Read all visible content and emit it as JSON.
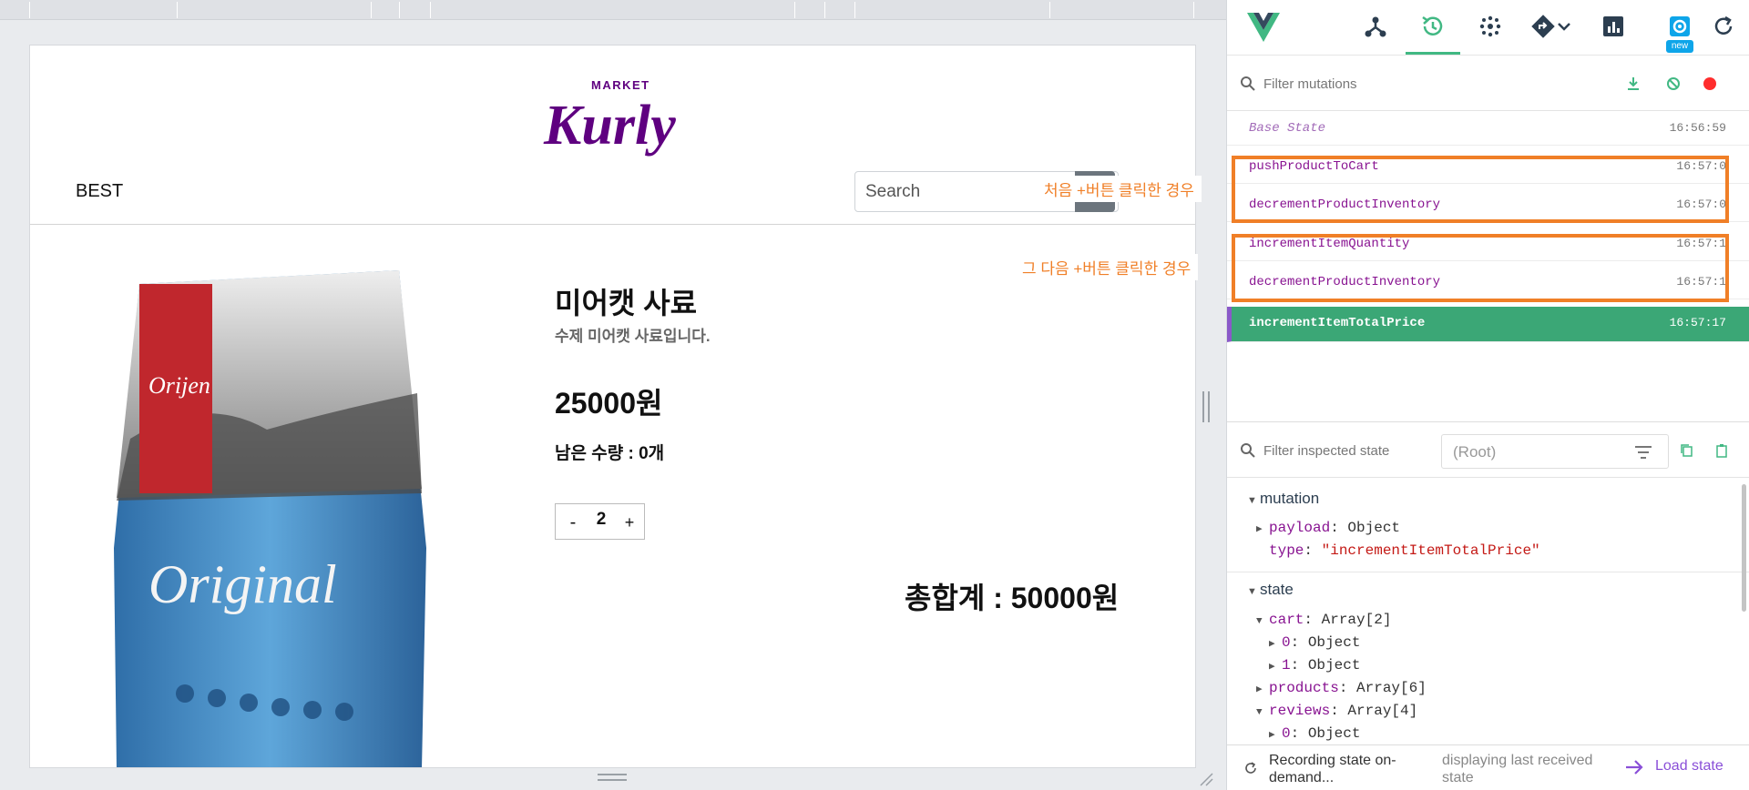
{
  "colors": {
    "accent_green": "#41b883",
    "active_row": "#3ba776",
    "annotation_orange": "#f07f27",
    "mutation_key": "#881391",
    "kurly_purple": "#5f0080"
  },
  "store": {
    "logo": {
      "top_text": "MARKET",
      "main_text": "Kurly"
    },
    "nav": {
      "best": "BEST"
    },
    "search": {
      "placeholder": "Search"
    },
    "product": {
      "title": "미어캣 사료",
      "description": "수제 미어캣 사료입니다.",
      "price": "25000원",
      "remaining": "남은 수량 : 0개",
      "quantity": {
        "minus": "-",
        "value": "2",
        "plus": "+"
      },
      "total": "총합계 : 50000원",
      "image_icon": "cat-food-bag-image",
      "bag_brand": "Orijen",
      "bag_label": "Original"
    }
  },
  "annotations": {
    "first_click": "처음 +버튼 클릭한 경우",
    "second_click": "그 다음 +버튼 클릭한 경우"
  },
  "devtools": {
    "toolbar_icons": [
      "vue-logo-icon",
      "component-tree-icon",
      "history-icon",
      "dots-grid-icon",
      "routing-icon",
      "chevron-down-icon",
      "chart-icon",
      "settings-icon",
      "refresh-icon"
    ],
    "new_badge": "new",
    "mutations_filter_placeholder": "Filter mutations",
    "mutations": [
      {
        "name": "Base State",
        "time": "16:56:59"
      },
      {
        "name": "pushProductToCart",
        "time": "16:57:0"
      },
      {
        "name": "decrementProductInventory",
        "time": "16:57:0"
      },
      {
        "name": "incrementItemQuantity",
        "time": "16:57:1"
      },
      {
        "name": "decrementProductInventory",
        "time": "16:57:1"
      },
      {
        "name": "incrementItemTotalPrice",
        "time": "16:57:17"
      }
    ],
    "state_filter_placeholder": "Filter inspected state",
    "root_select": "(Root)",
    "inspector": {
      "mutation_title": "mutation",
      "payload_key": "payload",
      "payload_val": "Object",
      "type_key": "type",
      "type_val": "\"incrementItemTotalPrice\"",
      "state_title": "state",
      "cart_key": "cart",
      "cart_val": "Array[2]",
      "cart0_key": "0",
      "cart0_val": "Object",
      "cart1_key": "1",
      "cart1_val": "Object",
      "products_key": "products",
      "products_val": "Array[6]",
      "reviews_key": "reviews",
      "reviews_val": "Array[4]",
      "reviews0_key": "0",
      "reviews0_val": "Object"
    },
    "footer": {
      "recording": "Recording state on-demand...",
      "displaying": "displaying last received state",
      "load_state": "Load state"
    }
  }
}
